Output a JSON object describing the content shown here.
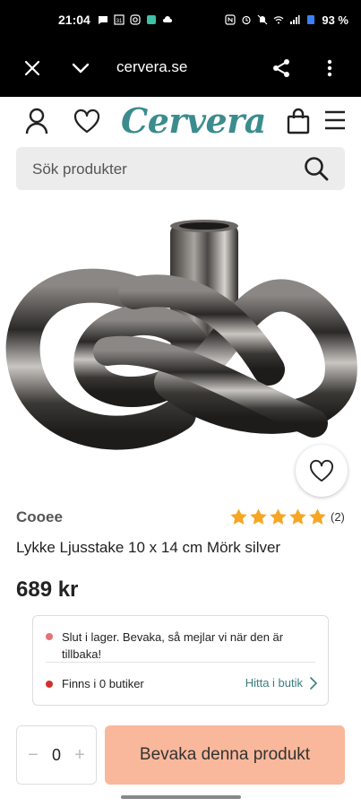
{
  "status_bar": {
    "time": "21:04",
    "battery": "93 %"
  },
  "browser": {
    "url": "cervera.se"
  },
  "site": {
    "logo_text": "Cervera",
    "brand_color": "#3c8c8e"
  },
  "search": {
    "placeholder": "Sök produkter"
  },
  "product": {
    "brand": "Cooee",
    "rating_stars": 5,
    "rating_count": "(2)",
    "title": "Lykke Ljusstake 10 x 14 cm Mörk silver",
    "price": "689 kr"
  },
  "stock": {
    "online_status": "Slut i lager. Bevaka, så mejlar vi när den är tillbaka!",
    "online_dot_color": "#e57373",
    "store_status": "Finns i 0 butiker",
    "store_dot_color": "#d32f2f",
    "find_in_store": "Hitta i butik"
  },
  "actions": {
    "quantity": "0",
    "minus": "−",
    "plus": "+",
    "cta_label": "Bevaka denna produkt",
    "cta_color": "#f9b89b"
  }
}
